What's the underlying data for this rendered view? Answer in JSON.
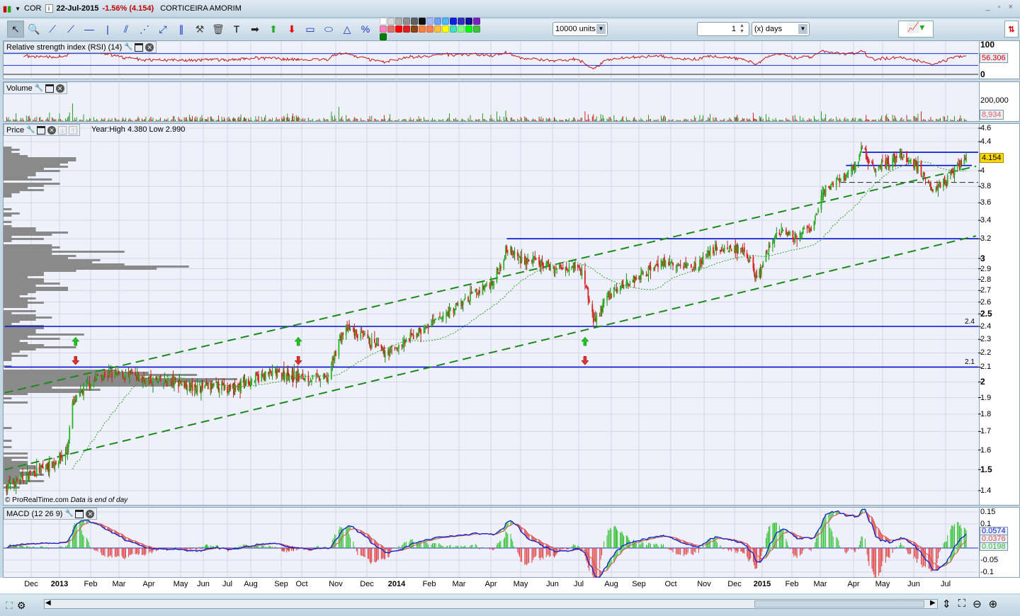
{
  "title_bar": {
    "symbol": "COR",
    "date": "22-Jul-2015",
    "change": "-1.56% (4.154)",
    "name": "CORTICEIRA AMORIM",
    "window_controls": "_ ▫ ×"
  },
  "toolbar": {
    "tools": [
      "select",
      "zoom",
      "line",
      "ray",
      "horizontal-line",
      "vertical-line",
      "channel",
      "fan",
      "segment",
      "parallel",
      "properties",
      "delete",
      "text",
      "arrow-right",
      "arrow-up",
      "arrow-down",
      "rectangle",
      "ellipse",
      "triangle",
      "percent"
    ],
    "palette": [
      "#ffffff",
      "#d8d8d8",
      "#b0b0b0",
      "#909090",
      "#606060",
      "#111111",
      "#a8b8ff",
      "#70a0ff",
      "#50b8ff",
      "#1020e0",
      "#3030c0",
      "#101090",
      "#8020c0",
      "#ff80c0",
      "#e07070",
      "#ff0000",
      "#e02020",
      "#8b4513",
      "#ff8040",
      "#ff7f50",
      "#ffc040",
      "#ffff00",
      "#40e0c0",
      "#80ff80",
      "#00ff00",
      "#40c040",
      "#008000"
    ],
    "units_select": "10000 units",
    "period_value": "1",
    "period_unit": "(x) days"
  },
  "rsi_panel": {
    "title": "Relative strength index (RSI) (14)",
    "axis": [
      "100",
      "0"
    ],
    "value": "56.306"
  },
  "volume_panel": {
    "title": "Volume",
    "axis": [
      "200,000"
    ],
    "value": "8,934"
  },
  "price_panel": {
    "title": "Price",
    "info": "Year:High 4.380 Low 2.990",
    "value": "4.154",
    "axis": [
      "4.6",
      "4.4",
      "4",
      "3.8",
      "3.6",
      "3.4",
      "3.2",
      "3",
      "2.9",
      "2.8",
      "2.7",
      "2.6",
      "2.5",
      "2.4",
      "2.3",
      "2.2",
      "2.1",
      "2",
      "1.9",
      "1.8",
      "1.7",
      "1.6",
      "1.5",
      "1.4"
    ],
    "level_labels": [
      "2.4",
      "2.1"
    ],
    "footer": "© ProRealTime.com",
    "footer_note": "Data is end of day"
  },
  "macd_panel": {
    "title": "MACD (12 26 9)",
    "axis": [
      "0.15",
      "0.1",
      "-0.05",
      "-0.1"
    ],
    "values": [
      "0.0574",
      "0.0376",
      "0.0198"
    ],
    "colors": [
      "#1020d0",
      "#e05050",
      "#30c030"
    ]
  },
  "x_axis": [
    "Dec",
    "2013",
    "Feb",
    "Mar",
    "Apr",
    "May",
    "Jun",
    "Jul",
    "Aug",
    "Sep",
    "Oct",
    "Nov",
    "Dec",
    "2014",
    "Feb",
    "Mar",
    "Apr",
    "May",
    "Jun",
    "Jul",
    "Aug",
    "Sep",
    "Oct",
    "Nov",
    "Dec",
    "2015",
    "Feb",
    "Mar",
    "Apr",
    "May",
    "Jun",
    "Jul"
  ],
  "chart_data": {
    "type": "candlestick",
    "scale": "log",
    "ylim": [
      1.4,
      4.6
    ],
    "grid": true,
    "last_close": 4.154,
    "year_high": 4.38,
    "year_low": 2.99,
    "closes": [
      [
        "2012-11-05",
        1.42
      ],
      [
        "2012-12-01",
        1.48
      ],
      [
        "2012-12-20",
        1.52
      ],
      [
        "2013-01-08",
        1.58
      ],
      [
        "2013-01-14",
        1.85
      ],
      [
        "2013-01-25",
        1.95
      ],
      [
        "2013-02-10",
        2.05
      ],
      [
        "2013-03-01",
        2.05
      ],
      [
        "2013-03-20",
        2.03
      ],
      [
        "2013-04-10",
        2.0
      ],
      [
        "2013-05-01",
        2.0
      ],
      [
        "2013-05-20",
        1.96
      ],
      [
        "2013-06-15",
        1.97
      ],
      [
        "2013-07-10",
        1.96
      ],
      [
        "2013-08-01",
        2.01
      ],
      [
        "2013-08-20",
        2.05
      ],
      [
        "2013-09-10",
        2.05
      ],
      [
        "2013-10-01",
        2.03
      ],
      [
        "2013-10-25",
        2.02
      ],
      [
        "2013-11-04",
        2.3
      ],
      [
        "2013-11-12",
        2.38
      ],
      [
        "2013-12-01",
        2.3
      ],
      [
        "2013-12-18",
        2.2
      ],
      [
        "2014-01-05",
        2.25
      ],
      [
        "2014-01-20",
        2.35
      ],
      [
        "2014-02-05",
        2.42
      ],
      [
        "2014-02-20",
        2.52
      ],
      [
        "2014-03-05",
        2.6
      ],
      [
        "2014-03-20",
        2.7
      ],
      [
        "2014-04-05",
        2.8
      ],
      [
        "2014-04-17",
        3.1
      ],
      [
        "2014-05-01",
        3.0
      ],
      [
        "2014-05-20",
        2.95
      ],
      [
        "2014-06-05",
        2.9
      ],
      [
        "2014-06-25",
        2.95
      ],
      [
        "2014-07-05",
        2.85
      ],
      [
        "2014-07-16",
        2.42
      ],
      [
        "2014-07-28",
        2.65
      ],
      [
        "2014-08-15",
        2.75
      ],
      [
        "2014-09-05",
        2.85
      ],
      [
        "2014-09-20",
        2.97
      ],
      [
        "2014-10-10",
        2.92
      ],
      [
        "2014-10-28",
        2.95
      ],
      [
        "2014-11-10",
        3.1
      ],
      [
        "2014-12-01",
        3.1
      ],
      [
        "2014-12-18",
        3.0
      ],
      [
        "2014-12-26",
        2.78
      ],
      [
        "2015-01-06",
        3.05
      ],
      [
        "2015-01-15",
        3.25
      ],
      [
        "2015-02-01",
        3.22
      ],
      [
        "2015-02-20",
        3.3
      ],
      [
        "2015-03-05",
        3.75
      ],
      [
        "2015-03-20",
        3.9
      ],
      [
        "2015-04-01",
        4.02
      ],
      [
        "2015-04-10",
        4.32
      ],
      [
        "2015-04-20",
        4.05
      ],
      [
        "2015-05-05",
        4.1
      ],
      [
        "2015-05-20",
        4.2
      ],
      [
        "2015-06-05",
        4.05
      ],
      [
        "2015-06-18",
        3.8
      ],
      [
        "2015-07-01",
        3.85
      ],
      [
        "2015-07-10",
        4.05
      ],
      [
        "2015-07-22",
        4.154
      ]
    ],
    "moving_average": {
      "type": "SMA",
      "period": 50,
      "color": "#30a030"
    },
    "horizontal_levels": [
      {
        "price": 2.1,
        "from": "2012-11-03"
      },
      {
        "price": 2.4,
        "from": "2012-11-03"
      },
      {
        "price": 3.2,
        "from": "2014-04-17"
      },
      {
        "price": 4.25,
        "from": "2015-04-10",
        "style": "solid"
      },
      {
        "price": 4.07,
        "from": "2015-03-25",
        "style": "short"
      },
      {
        "price": 3.85,
        "from": "2015-03-20",
        "style": "dashed-black"
      }
    ],
    "trendlines": [
      {
        "from": [
          "2012-11-03",
          1.93
        ],
        "to": [
          "2015-08-01",
          4.06
        ]
      },
      {
        "from": [
          "2012-11-03",
          1.5
        ],
        "to": [
          "2015-08-01",
          3.23
        ]
      }
    ],
    "arrows": [
      {
        "date": "2013-01-17",
        "dir": "up",
        "price": 2.28
      },
      {
        "date": "2013-01-17",
        "dir": "down",
        "price": 2.15
      },
      {
        "date": "2013-09-26",
        "dir": "up",
        "price": 2.28
      },
      {
        "date": "2013-09-26",
        "dir": "down",
        "price": 2.15
      },
      {
        "date": "2014-07-07",
        "dir": "up",
        "price": 2.28
      },
      {
        "date": "2014-07-07",
        "dir": "down",
        "price": 2.15
      }
    ],
    "indicators": {
      "rsi_period": 14,
      "macd": [
        12,
        26,
        9
      ]
    }
  }
}
